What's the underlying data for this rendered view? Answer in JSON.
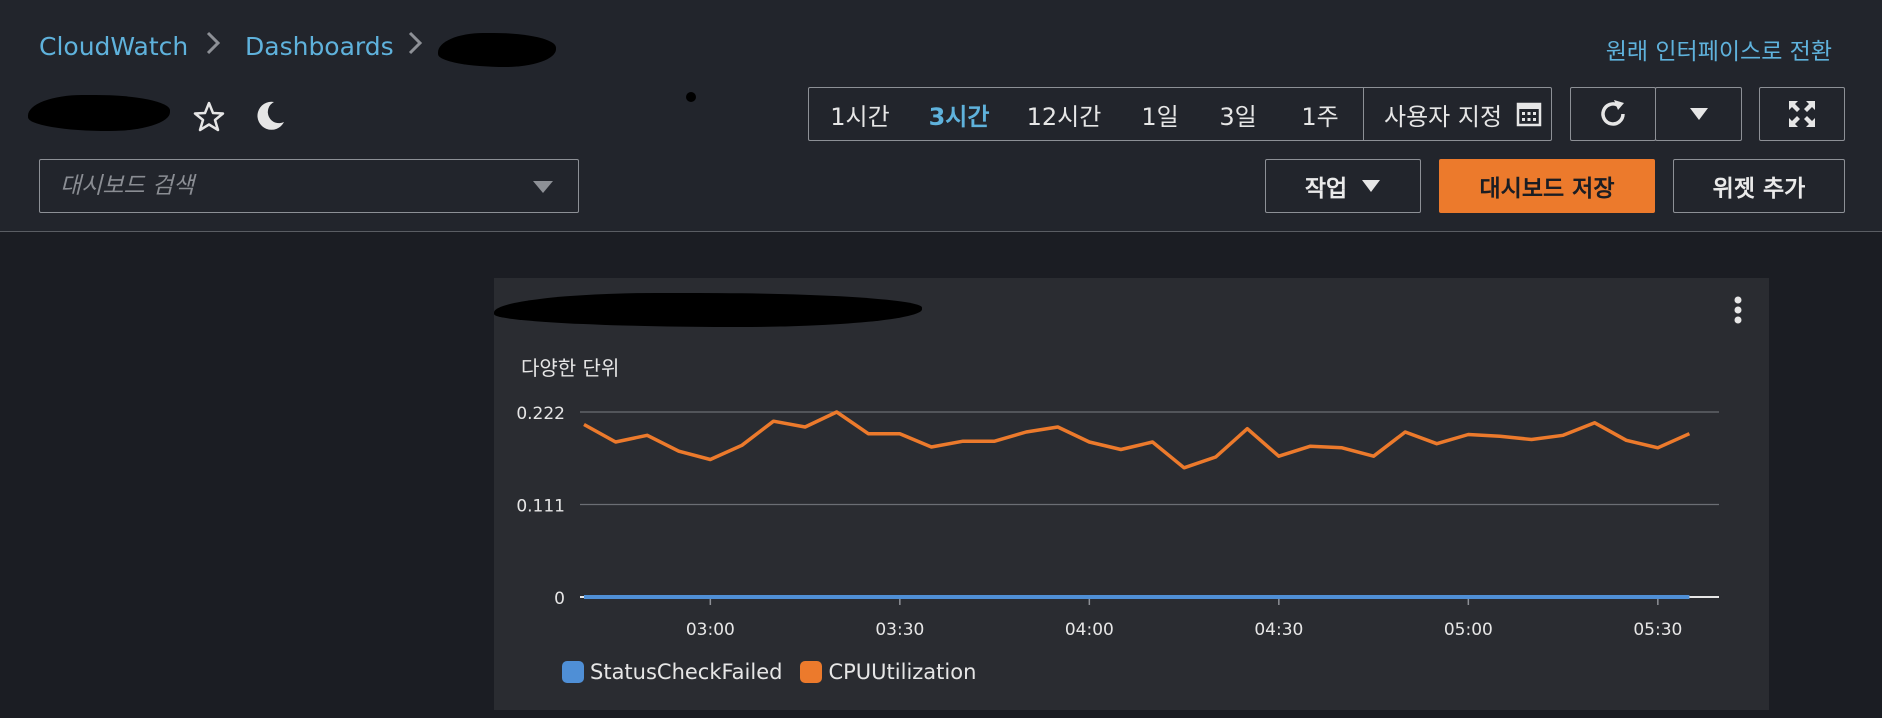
{
  "breadcrumb": {
    "items": [
      "CloudWatch",
      "Dashboards"
    ]
  },
  "header": {
    "switch_link": "원래 인터페이스로 전환"
  },
  "time_range": {
    "options": [
      "1시간",
      "3시간",
      "12시간",
      "1일",
      "3일",
      "1주"
    ],
    "selected": "3시간",
    "custom_label": "사용자 지정"
  },
  "search": {
    "placeholder": "대시보드 검색"
  },
  "toolbar": {
    "actions_label": "작업",
    "save_label": "대시보드 저장",
    "add_widget_label": "위젯 추가"
  },
  "widget": {
    "subtitle": "다양한 단위"
  },
  "colors": {
    "accent": "#5fb2dc",
    "primary_button": "#ec7a2c",
    "series_status": "#4f8fd6",
    "series_cpu": "#ec7a2c"
  },
  "icons": {
    "favorite": "star-icon",
    "theme": "moon-icon",
    "calendar": "calendar-icon",
    "refresh": "refresh-icon",
    "dropdown": "caret-down-icon",
    "fullscreen": "fullscreen-icon",
    "more": "vertical-dots-icon"
  },
  "chart_data": {
    "type": "line",
    "title": "",
    "xlabel": "",
    "ylabel": "다양한 단위",
    "ylim": [
      0,
      0.222
    ],
    "yticks": [
      "0.222",
      "0.111",
      "0"
    ],
    "xticks": [
      "03:00",
      "03:30",
      "04:00",
      "04:30",
      "05:00",
      "05:30"
    ],
    "grid": true,
    "legend": "bottom-left",
    "x": [
      "02:40",
      "02:45",
      "02:50",
      "02:55",
      "03:00",
      "03:05",
      "03:10",
      "03:15",
      "03:20",
      "03:25",
      "03:30",
      "03:35",
      "03:40",
      "03:45",
      "03:50",
      "03:55",
      "04:00",
      "04:05",
      "04:10",
      "04:15",
      "04:20",
      "04:25",
      "04:30",
      "04:35",
      "04:40",
      "04:45",
      "04:50",
      "04:55",
      "05:00",
      "05:05",
      "05:10",
      "05:15",
      "05:20",
      "05:25",
      "05:30",
      "05:35"
    ],
    "series": [
      {
        "name": "StatusCheckFailed",
        "values": [
          0,
          0,
          0,
          0,
          0,
          0,
          0,
          0,
          0,
          0,
          0,
          0,
          0,
          0,
          0,
          0,
          0,
          0,
          0,
          0,
          0,
          0,
          0,
          0,
          0,
          0,
          0,
          0,
          0,
          0,
          0,
          0,
          0,
          0,
          0,
          0
        ]
      },
      {
        "name": "CPUUtilization",
        "values": [
          0.207,
          0.186,
          0.194,
          0.175,
          0.165,
          0.182,
          0.211,
          0.204,
          0.222,
          0.196,
          0.196,
          0.18,
          0.187,
          0.187,
          0.198,
          0.204,
          0.186,
          0.177,
          0.186,
          0.155,
          0.168,
          0.202,
          0.169,
          0.181,
          0.179,
          0.169,
          0.198,
          0.184,
          0.195,
          0.193,
          0.189,
          0.194,
          0.209,
          0.188,
          0.179,
          0.196
        ]
      }
    ]
  }
}
